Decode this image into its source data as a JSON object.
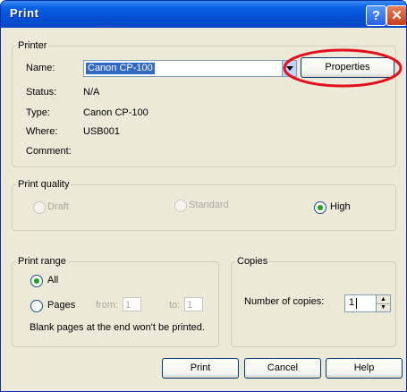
{
  "window": {
    "title": "Print",
    "help_glyph": "?",
    "close_glyph": "✕"
  },
  "printer": {
    "legend": "Printer",
    "name_label": "Name:",
    "name_value": "Canon CP-100",
    "properties_button": "Properties",
    "status_label": "Status:",
    "status_value": "N/A",
    "type_label": "Type:",
    "type_value": "Canon CP-100",
    "where_label": "Where:",
    "where_value": "USB001",
    "comment_label": "Comment:"
  },
  "quality": {
    "legend": "Print quality",
    "options": [
      {
        "label": "Draft",
        "selected": false,
        "enabled": false
      },
      {
        "label": "Standard",
        "selected": false,
        "enabled": false
      },
      {
        "label": "High",
        "selected": true,
        "enabled": true
      }
    ]
  },
  "range": {
    "legend": "Print range",
    "all_label": "All",
    "pages_label": "Pages",
    "from_label": "from:",
    "from_value": "1",
    "to_label": "to:",
    "to_value": "1",
    "note": "Blank pages at the end won't be printed."
  },
  "copies": {
    "legend": "Copies",
    "label": "Number of copies:",
    "value": "1"
  },
  "buttons": {
    "print": "Print",
    "cancel": "Cancel",
    "help": "Help"
  },
  "annotation_color": "#e0101e",
  "accent": "#316ac5"
}
